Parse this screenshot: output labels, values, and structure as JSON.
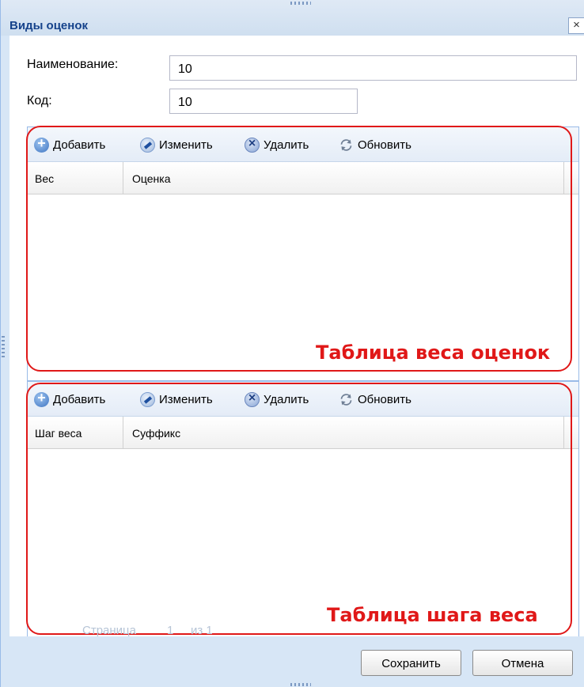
{
  "window": {
    "title": "Виды оценок",
    "close_glyph": "×"
  },
  "form": {
    "name_label": "Наименование:",
    "name_value": "10",
    "code_label": "Код:",
    "code_value": "10"
  },
  "toolbar": {
    "add_label": "Добавить",
    "edit_label": "Изменить",
    "delete_label": "Удалить",
    "refresh_label": "Обновить"
  },
  "grid1": {
    "columns": [
      "Вес",
      "Оценка"
    ],
    "annotation": "Таблица веса оценок"
  },
  "grid2": {
    "columns": [
      "Шаг веса",
      "Суффикс"
    ],
    "annotation": "Таблица шага веса"
  },
  "pager": {
    "page_label": "Страница",
    "page_value": "1",
    "of_label": "из 1"
  },
  "buttons": {
    "save_label": "Сохранить",
    "cancel_label": "Отмена"
  },
  "colors": {
    "accent": "#15428b",
    "annotation": "#e01818",
    "frame": "#d7e6f6"
  },
  "icons": {
    "add": "plus-circle-icon",
    "edit": "pencil-icon",
    "delete": "x-circle-icon",
    "refresh": "refresh-icon",
    "close": "close-icon"
  }
}
